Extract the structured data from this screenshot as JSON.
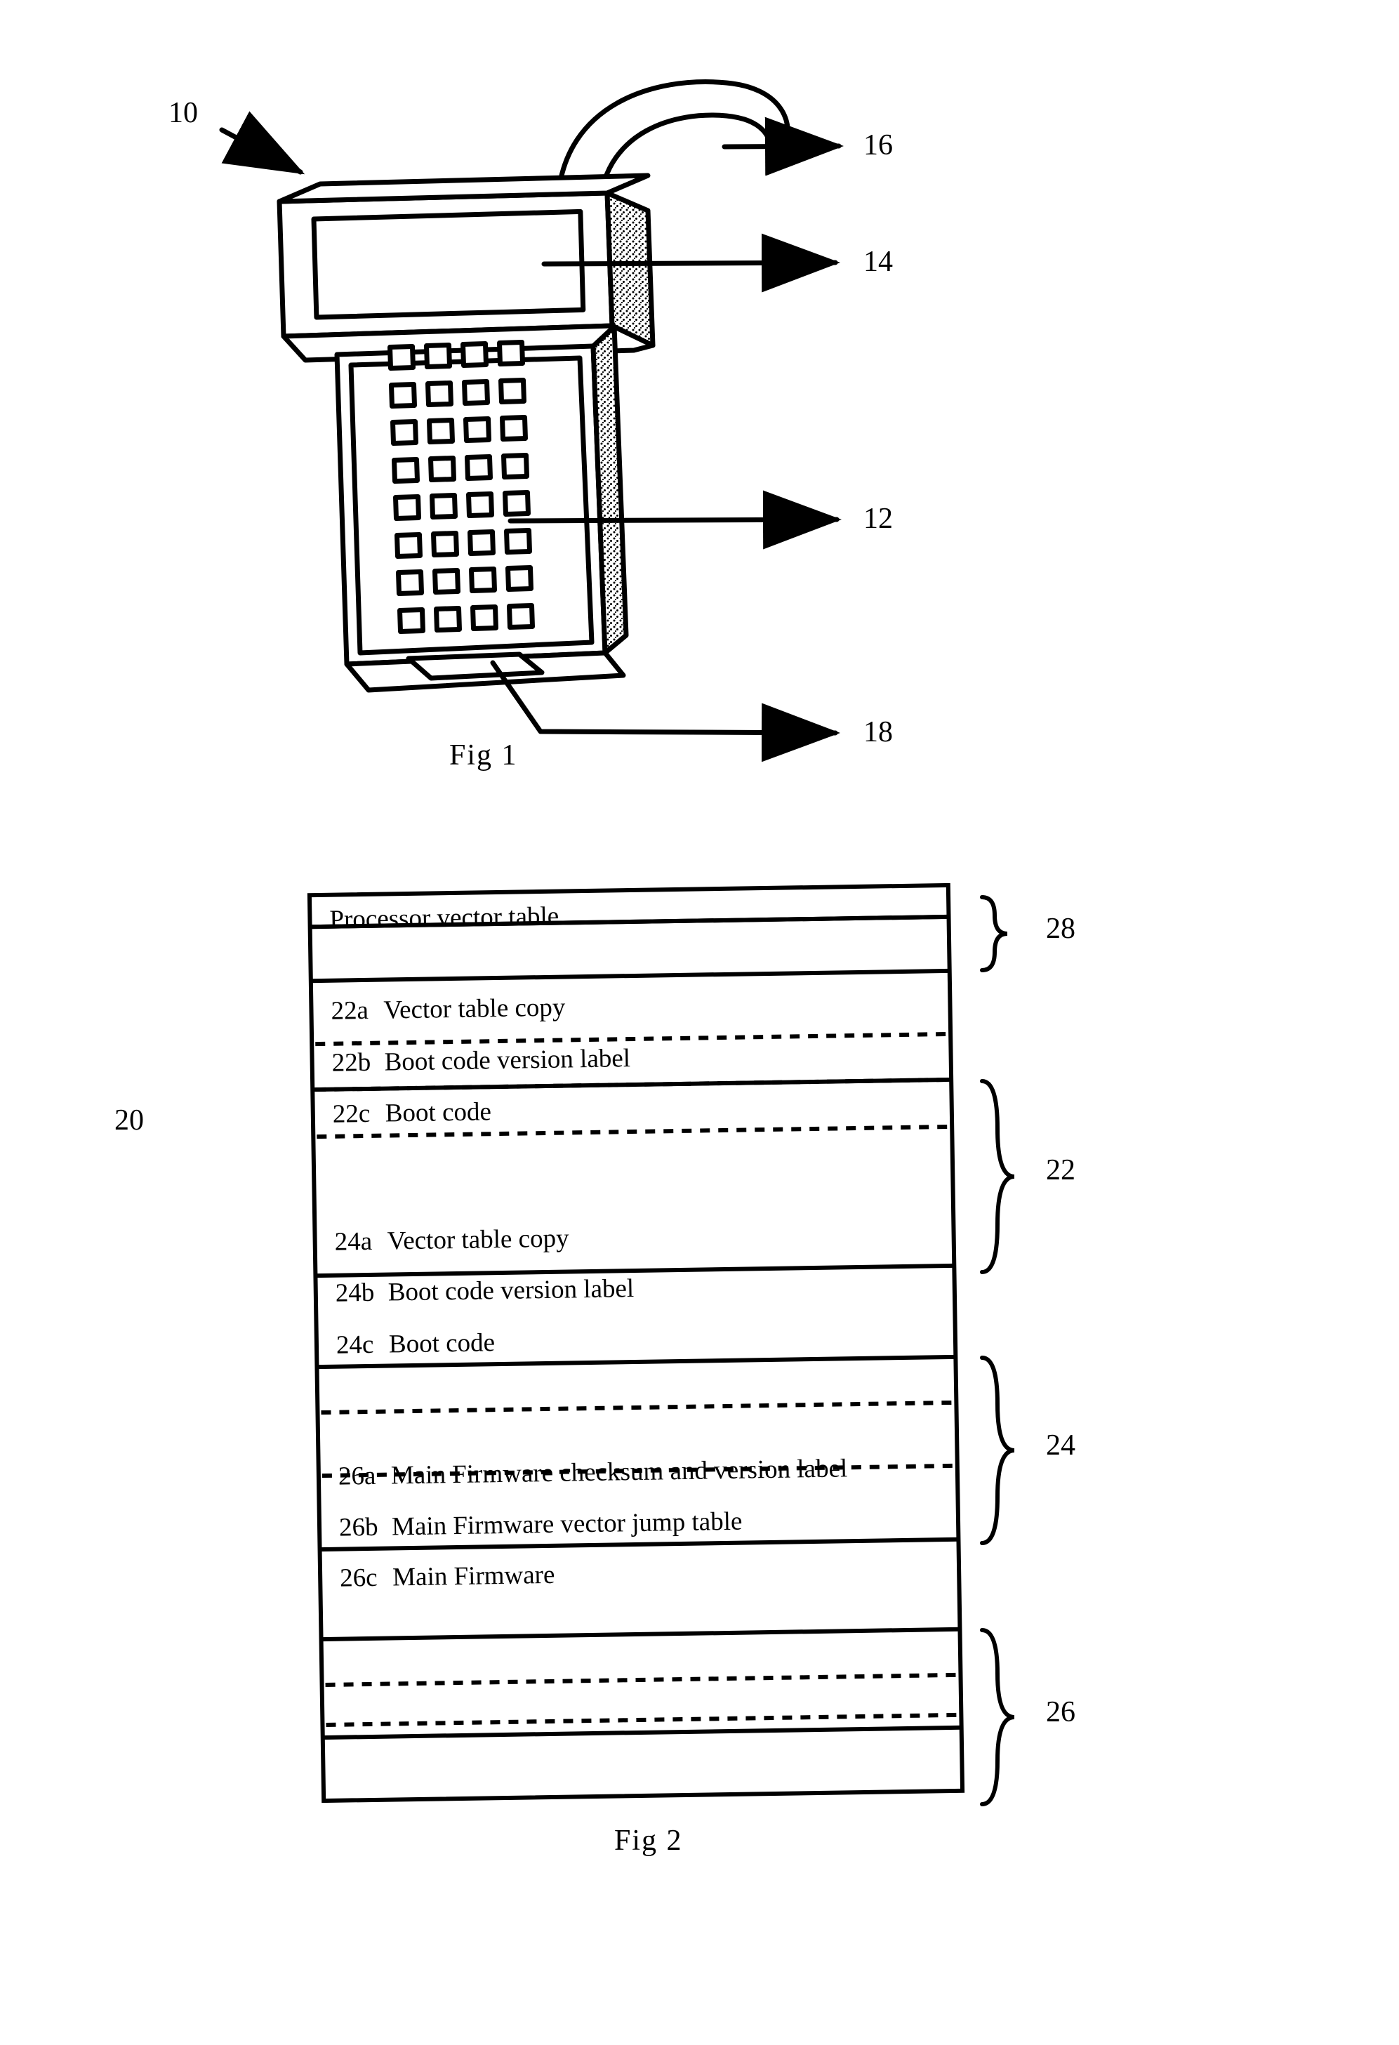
{
  "figure1": {
    "caption": "Fig 1",
    "callouts": [
      {
        "id": "10",
        "target": "handheld-terminal-device"
      },
      {
        "id": "16",
        "target": "hand-strap-handle"
      },
      {
        "id": "14",
        "target": "display-screen"
      },
      {
        "id": "12",
        "target": "keypad"
      },
      {
        "id": "18",
        "target": "connector-port"
      }
    ],
    "keypad": {
      "rows": 8,
      "cols": 4
    }
  },
  "figure2": {
    "caption": "Fig 2",
    "memory_map_id": "20",
    "braces": [
      {
        "id": "28",
        "label": "processor-vector-table-region"
      },
      {
        "id": "22",
        "label": "first-boot-block"
      },
      {
        "id": "24",
        "label": "second-boot-block"
      },
      {
        "id": "26",
        "label": "main-firmware-block"
      }
    ],
    "rows": [
      {
        "ref": "",
        "text": "Processor vector table",
        "type": "solid"
      },
      {
        "ref": "",
        "text": "",
        "type": "empty"
      },
      {
        "ref": "22a",
        "text": "Vector table copy",
        "type": "solid"
      },
      {
        "ref": "22b",
        "text": "Boot code version label",
        "type": "dashed"
      },
      {
        "ref": "22c",
        "text": "Boot code",
        "type": "dashed"
      },
      {
        "ref": "",
        "text": "",
        "type": "empty"
      },
      {
        "ref": "24a",
        "text": "Vector table copy",
        "type": "solid"
      },
      {
        "ref": "24b",
        "text": "Boot code version label",
        "type": "dashed"
      },
      {
        "ref": "24c",
        "text": "Boot code",
        "type": "dashed"
      },
      {
        "ref": "",
        "text": "",
        "type": "empty"
      },
      {
        "ref": "26a",
        "text": "Main Firmware checksum and version label",
        "type": "solid"
      },
      {
        "ref": "26b",
        "text": "Main Firmware vector jump table",
        "type": "dashed"
      },
      {
        "ref": "26c",
        "text": "Main Firmware",
        "type": "dashed"
      },
      {
        "ref": "",
        "text": "",
        "type": "empty"
      }
    ]
  },
  "colors": {
    "ink": "#000000",
    "paper": "#ffffff",
    "stipple": "#000000"
  }
}
